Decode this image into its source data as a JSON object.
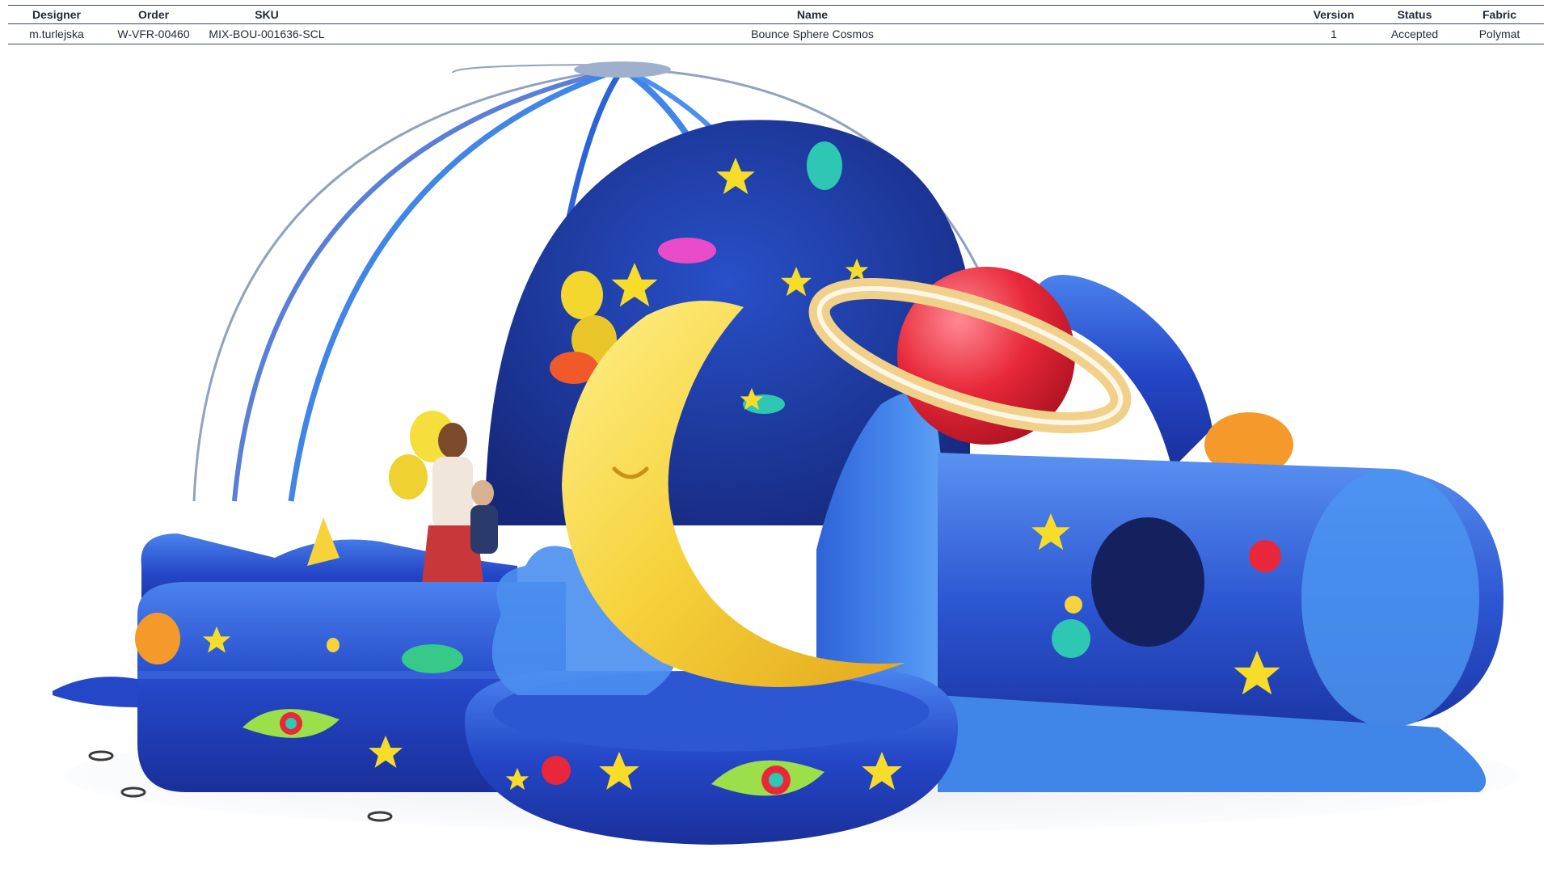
{
  "header": {
    "columns": [
      "Designer",
      "Order",
      "SKU",
      "Name",
      "Version",
      "Status",
      "Fabric"
    ],
    "row": [
      "m.turlejska",
      "W-VFR-00460",
      "MIX-BOU-001636-SCL",
      "Bounce Sphere Cosmos",
      "1",
      "Accepted",
      "Polymat"
    ]
  },
  "palette": {
    "royal_blue": "#2447c8",
    "sky_blue": "#3f86e8",
    "deep_navy": "#1c2f8f",
    "moon_yellow": "#f6d23c",
    "planet_red": "#e8283a",
    "star_yellow": "#f7dc2a"
  }
}
